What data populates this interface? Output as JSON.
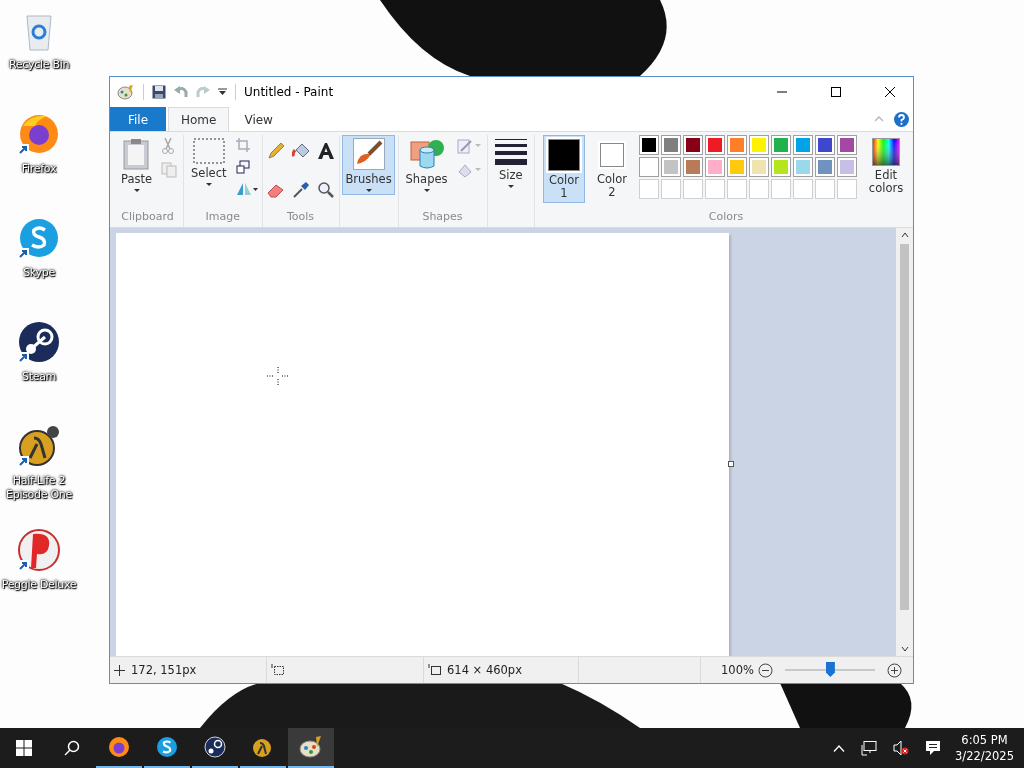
{
  "desktop_icons": [
    {
      "label": "Recycle Bin",
      "kind": "recycle",
      "shortcut": false
    },
    {
      "label": "Firefox",
      "kind": "firefox",
      "shortcut": true
    },
    {
      "label": "Skype",
      "kind": "skype",
      "shortcut": true
    },
    {
      "label": "Steam",
      "kind": "steam",
      "shortcut": true
    },
    {
      "label": "Half-Life 2 Episode One",
      "kind": "halflife",
      "shortcut": true
    },
    {
      "label": "Peggle Deluxe",
      "kind": "peggle",
      "shortcut": true
    }
  ],
  "window": {
    "title": "Untitled - Paint"
  },
  "ribbon_tabs": [
    {
      "label": "File",
      "kind": "file",
      "selected": false
    },
    {
      "label": "Home",
      "kind": "tab",
      "selected": true
    },
    {
      "label": "View",
      "kind": "tab",
      "selected": false
    }
  ],
  "ribbon": {
    "clipboard": {
      "label": "Clipboard",
      "paste": "Paste"
    },
    "image": {
      "label": "Image",
      "select": "Select"
    },
    "tools": {
      "label": "Tools"
    },
    "brushes": {
      "label": "Brushes",
      "selected": true
    },
    "shapes": {
      "label": "Shapes",
      "button": "Shapes"
    },
    "size": {
      "button": "Size"
    },
    "colors": {
      "label": "Colors",
      "edit": "Edit colors",
      "slots": [
        {
          "label": "Color 1",
          "color": "#000000",
          "selected": true
        },
        {
          "label": "Color 2",
          "color": "#ffffff",
          "selected": false
        }
      ],
      "palette": [
        {
          "color": "#000000"
        },
        {
          "color": "#7f7f7f"
        },
        {
          "color": "#880015"
        },
        {
          "color": "#ed1c24"
        },
        {
          "color": "#ff7f27"
        },
        {
          "color": "#fff200"
        },
        {
          "color": "#22b14c"
        },
        {
          "color": "#00a2e8"
        },
        {
          "color": "#3f48cc"
        },
        {
          "color": "#a349a4"
        },
        {
          "color": "#ffffff"
        },
        {
          "color": "#c3c3c3"
        },
        {
          "color": "#b97a57"
        },
        {
          "color": "#ffaec9"
        },
        {
          "color": "#ffc90e"
        },
        {
          "color": "#efe4b0"
        },
        {
          "color": "#b5e61d"
        },
        {
          "color": "#99d9ea"
        },
        {
          "color": "#7092be"
        },
        {
          "color": "#c8bfe7"
        }
      ]
    }
  },
  "status_bar": {
    "cursor_position": "172, 151px",
    "canvas_size": "614 × 460px",
    "zoom": "100%",
    "zoom_level": {
      "level": 0.5
    }
  },
  "taskbar": {
    "apps": [
      {
        "kind": "firefox",
        "selected": false
      },
      {
        "kind": "skype",
        "selected": false
      },
      {
        "kind": "steam",
        "selected": false
      },
      {
        "kind": "halflife",
        "selected": false
      },
      {
        "kind": "paint",
        "selected": true
      }
    ],
    "time": "6:05 PM",
    "date": "3/22/2025"
  }
}
